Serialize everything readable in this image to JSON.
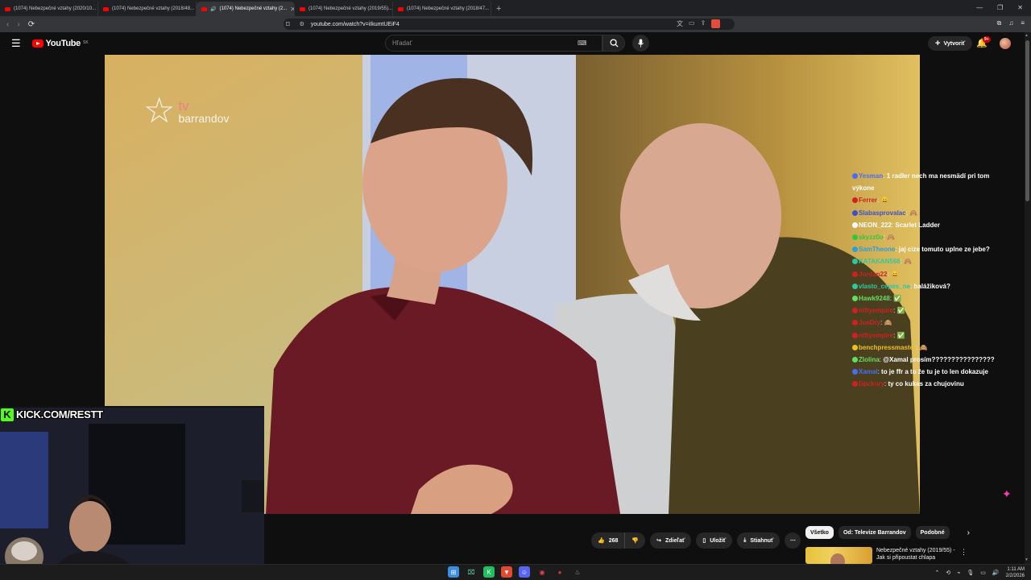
{
  "browser": {
    "tabs": [
      {
        "title": "(1074) Nebezpečné vztahy (2020/10..."
      },
      {
        "title": "(1074) Nebezpečné vztahy (2018/48..."
      },
      {
        "title": "(1074) Nebezpečné vztahy (2..."
      },
      {
        "title": "(1074) Nebezpečné vztahy (2019/55)..."
      },
      {
        "title": "(1074) Nebezpečné vztahy (2018/47..."
      }
    ],
    "url": "youtube.com/watch?v=iIkumtUEiF4"
  },
  "youtube": {
    "logo_text": "YouTube",
    "region": "SK",
    "search_placeholder": "Hľadať",
    "create_label": "Vytvoriť",
    "notif_count": "9+"
  },
  "video": {
    "watermark_tv": "tv",
    "watermark_brand": "barrandov"
  },
  "chat": [
    {
      "user": "Yesman",
      "user_color": "#4a6cf7",
      "text": "1 radler nech ma nesmädí pri tom výkone"
    },
    {
      "user": "Ferrer",
      "user_color": "#d02020",
      "text": "😀"
    },
    {
      "user": "Slabasprovalac",
      "user_color": "#3a50d0",
      "text": "🙈"
    },
    {
      "user": "NEON_222",
      "user_color": "#ffffff",
      "text": "Scarlet Ladder"
    },
    {
      "user": "skyzz0o",
      "user_color": "#2ec840",
      "text": "🙈"
    },
    {
      "user": "SamTheone",
      "user_color": "#2aa0d8",
      "text": "jaj cize tomuto uplne ze jebe?"
    },
    {
      "user": "KATAKAN566",
      "user_color": "#2ec8a0",
      "text": "🙈"
    },
    {
      "user": "Jordan22",
      "user_color": "#d02020",
      "text": "😄"
    },
    {
      "user": "vlasto_cepes_ne",
      "user_color": "#2ec8a0",
      "text": "balážiková?"
    },
    {
      "user": "Hawk9248",
      "user_color": "#60e060",
      "text": "✅"
    },
    {
      "user": "niftyempire",
      "user_color": "#d02020",
      "text": "✅"
    },
    {
      "user": "JoeDry",
      "user_color": "#d02020",
      "text": "🙈"
    },
    {
      "user": "niftyempire",
      "user_color": "#d02020",
      "text": "✅"
    },
    {
      "user": "benchpressmaster",
      "user_color": "#f0c020",
      "text": "🙈"
    },
    {
      "user": "Zlolina",
      "user_color": "#60e060",
      "text": "@Xamal prosím????????????????"
    },
    {
      "user": "Xamal",
      "user_color": "#4a6cf7",
      "text": "to je ffr a to že tu je to len dokazuje"
    },
    {
      "user": "Dpckury",
      "user_color": "#d02020",
      "text": "ty co kukas za chujovinu"
    }
  ],
  "webcam": {
    "banner": "KICK.COM/RESTT",
    "banner_k": "K"
  },
  "actions": {
    "like_count": "268",
    "share_label": "Zdieľať",
    "save_label": "Uložiť",
    "download_label": "Stiahnuť"
  },
  "chips": [
    "Všetko",
    "Od: Televize Barrandov",
    "Podobné"
  ],
  "recommended": {
    "title": "Nebezpečné vztahy (2019/55) - Jak si připoustat chlapa"
  },
  "taskbar": {
    "time": "1:11 AM",
    "date": "2/2/2026"
  }
}
